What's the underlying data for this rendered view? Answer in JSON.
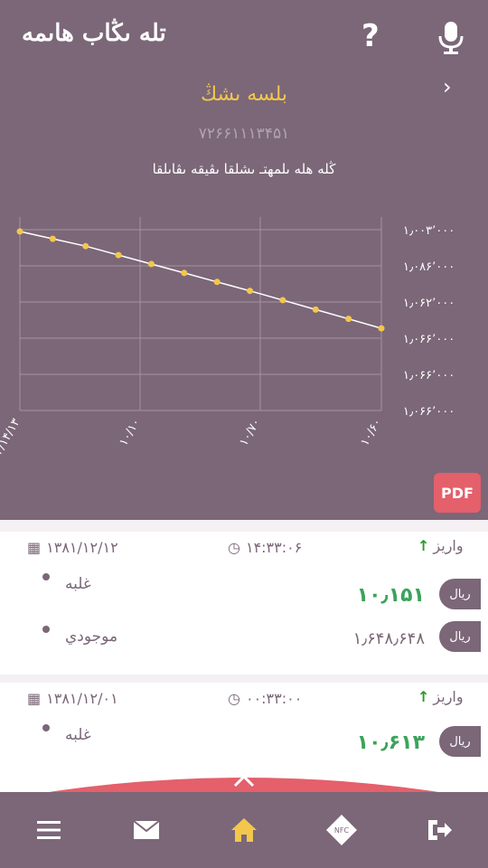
{
  "header": {
    "title": "تله ىڭاب هاىمه",
    "help_icon": "?"
  },
  "account": {
    "title": "بلسه ىشڭ",
    "number": "۷۲۶۶۱۱۱۳۴۵۱"
  },
  "chart_data": {
    "type": "line",
    "title": "ڭله هله ىلمهتـ ىشلقا ىڤيقه ىڤاىلقا",
    "y_ticks": [
      "۱٫۰۰۳٬۰۰۰",
      "۱٫۰۸۶٬۰۰۰",
      "۱٫۰۶۲٬۰۰۰",
      "۱٫۰۶۶٬۰۰۰",
      "۱٫۰۶۶٬۰۰۰",
      "۱٫۰۶۶٬۰۰۰"
    ],
    "x_ticks": [
      "۱۴/۱۴/۱۳",
      "۱۰/۱۰",
      "۱۰/۷۰",
      "۱۰/۶۰"
    ],
    "values": [
      1.0,
      0.955,
      0.91,
      0.855,
      0.8,
      0.745,
      0.69,
      0.635,
      0.578,
      0.52,
      0.463,
      0.405
    ],
    "ylim": [
      0,
      1
    ]
  },
  "pdf_label": "PDF",
  "transactions": [
    {
      "date": "۱۳۸۱/۱۲/۱۲",
      "time": "۱۴:۳۳:۰۶",
      "direction": "واريز",
      "rows": [
        {
          "label": "غلبه",
          "value": "۱۰٫۱۵۱",
          "pill": "ريال"
        },
        {
          "label": "موجودي",
          "value": "۱٫۶۴۸٫۶۴۸",
          "pill": "ريال"
        }
      ]
    },
    {
      "date": "۱۳۸۱/۱۲/۰۱",
      "time": "۰۰:۳۳:۰۰",
      "direction": "واريز",
      "rows": [
        {
          "label": "غلبه",
          "value": "۱۰٫۶۱۳",
          "pill": "ريال"
        }
      ]
    }
  ],
  "colors": {
    "primary": "#7b6778",
    "accent": "#f4c64c",
    "danger": "#e4606b",
    "positive": "#3ba35b"
  },
  "nav": [
    "exit-icon",
    "nfc-icon",
    "home-icon",
    "mail-icon",
    "menu-icon"
  ]
}
